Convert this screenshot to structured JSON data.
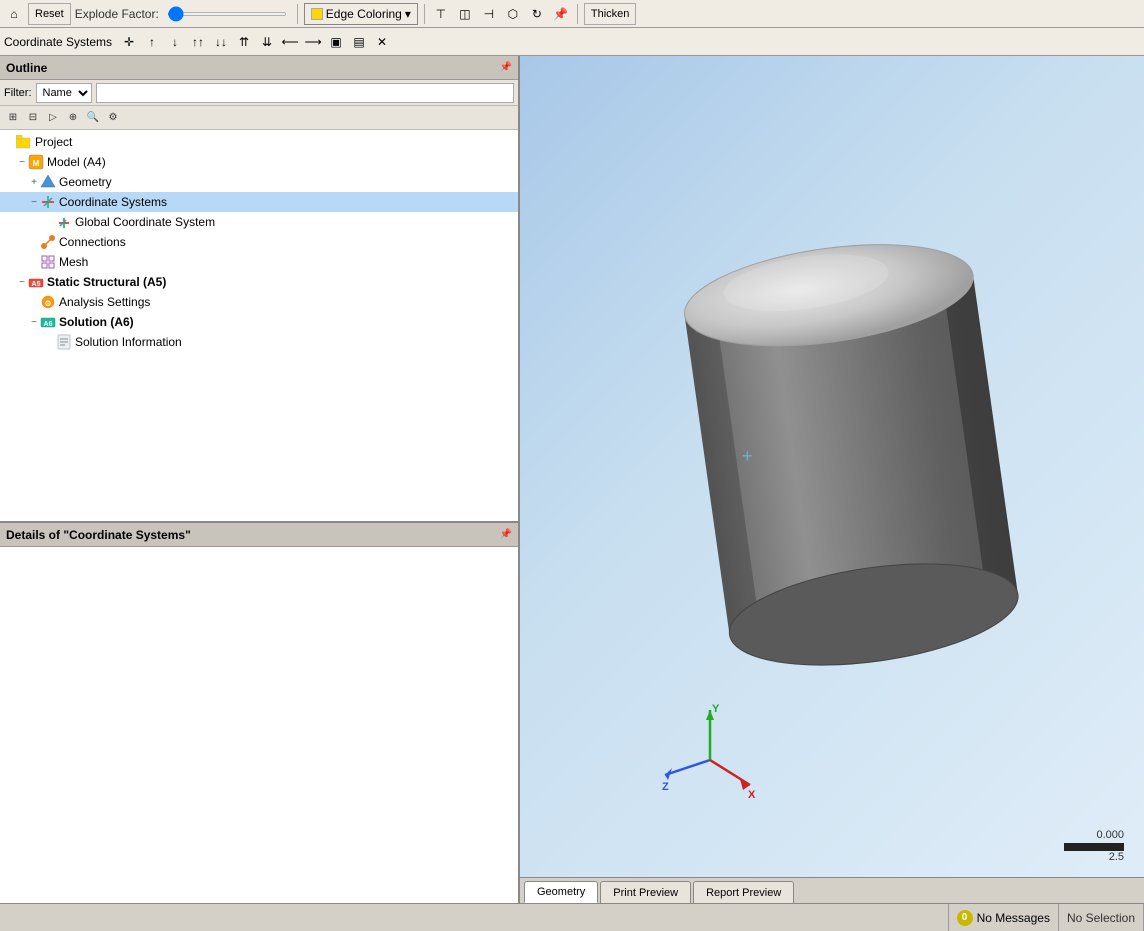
{
  "toolbar": {
    "reset_label": "Reset",
    "explode_label": "Explode Factor:",
    "edge_coloring_label": "Edge Coloring",
    "thicken_label": "Thicken"
  },
  "coord_toolbar": {
    "label": "Coordinate Systems"
  },
  "outline": {
    "header": "Outline",
    "filter_label": "Filter:",
    "filter_option": "Name",
    "pin": "📌"
  },
  "tree": {
    "items": [
      {
        "id": "project",
        "label": "Project",
        "indent": 0,
        "icon": "folder",
        "expanded": true
      },
      {
        "id": "model",
        "label": "Model (A4)",
        "indent": 1,
        "icon": "model",
        "expanded": true
      },
      {
        "id": "geometry",
        "label": "Geometry",
        "indent": 2,
        "icon": "geometry",
        "expanded": false
      },
      {
        "id": "coord-systems",
        "label": "Coordinate Systems",
        "indent": 2,
        "icon": "coord",
        "expanded": true
      },
      {
        "id": "global-coord",
        "label": "Global Coordinate System",
        "indent": 3,
        "icon": "global",
        "expanded": false
      },
      {
        "id": "connections",
        "label": "Connections",
        "indent": 2,
        "icon": "connections",
        "expanded": false
      },
      {
        "id": "mesh",
        "label": "Mesh",
        "indent": 2,
        "icon": "mesh",
        "expanded": false
      },
      {
        "id": "static-structural",
        "label": "Static Structural (A5)",
        "indent": 1,
        "icon": "static",
        "expanded": true
      },
      {
        "id": "analysis-settings",
        "label": "Analysis Settings",
        "indent": 2,
        "icon": "analysis",
        "expanded": false
      },
      {
        "id": "solution",
        "label": "Solution (A6)",
        "indent": 2,
        "icon": "solution",
        "expanded": true
      },
      {
        "id": "solution-info",
        "label": "Solution Information",
        "indent": 3,
        "icon": "info",
        "expanded": false
      }
    ]
  },
  "details": {
    "header": "Details of \"Coordinate Systems\"",
    "pin": "📌"
  },
  "tabs": [
    {
      "id": "geometry",
      "label": "Geometry",
      "active": true
    },
    {
      "id": "print-preview",
      "label": "Print Preview",
      "active": false
    },
    {
      "id": "report-preview",
      "label": "Report Preview",
      "active": false
    }
  ],
  "scale": {
    "value_top": "0.000",
    "value_bottom": "2.5"
  },
  "status": {
    "no_messages_label": "No Messages",
    "no_selection_label": "No Selection"
  }
}
